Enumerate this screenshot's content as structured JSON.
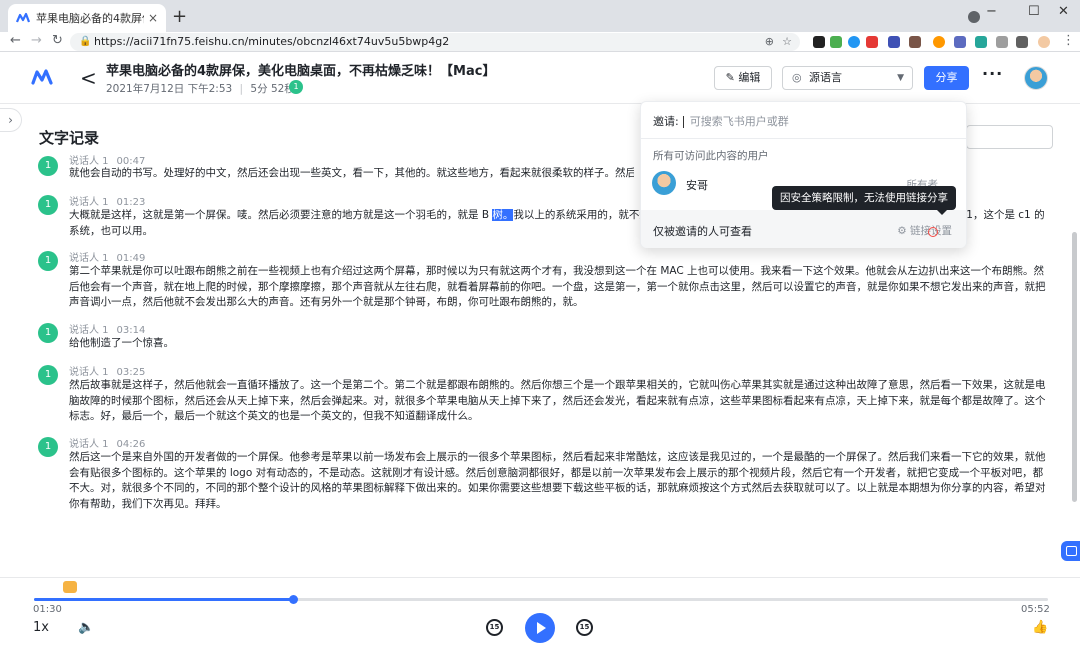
{
  "browser": {
    "tab_title": "苹果电脑必备的4款屏保，美化电脑",
    "tab_close": "×",
    "new_tab": "+",
    "url": "https://acii71fn75.feishu.cn/minutes/obcnzl46xt74uv5u5bwp4g2",
    "window_controls": [
      "−",
      "☐",
      "✕"
    ],
    "nav": {
      "back": "←",
      "forward": "→",
      "reload": "↻"
    },
    "extension_badges": [
      "14",
      "221",
      "0"
    ]
  },
  "header": {
    "back": "<",
    "title": "苹果电脑必备的4款屏保，美化电脑桌面，不再枯燥乏味！【Mac】",
    "date": "2021年7月12日 下午2:53",
    "duration": "5分 52秒",
    "participant_count": "1",
    "edit_label": "编辑",
    "lang_label": "源语言",
    "share_label": "分享",
    "more": "···",
    "brand_color": "#3370ff"
  },
  "transcript": {
    "title": "文字记录",
    "segments": [
      {
        "avatar": "1",
        "speaker": "说话人 1",
        "time": "00:47",
        "text": "就他会自动的书写。处理好的中文，然后还会出现一些英文，看一下，其他的。就这些地方，看起来就很柔软的样子。然后还有"
      },
      {
        "avatar": "1",
        "speaker": "说话人 1",
        "time": "01:23",
        "text_before": "大概就是这样，这就是第一个屏保。唛。然后必须要注意的地方就是这一个羽毛的，就是 B ",
        "text_highlight": "树。",
        "text_after": "我以上的系统采用的，就不知道                                                                                                            这个系统是最新的 mac os 12 码，他也可以用。然后这一个事实1，这个是 c1 的系统，也可以用。"
      },
      {
        "avatar": "1",
        "speaker": "说话人 1",
        "time": "01:49",
        "text": "第二个苹果就是你可以吐跟布朗熊之前在一些视频上也有介绍过这两个屏幕，那时候以为只有就这两个才有，我没想到这一个在 MAC 上也可以使用。我来看一下这个效果。他就会从左边扒出来这一个布朗熊。然后他会有一个声音，就在地上爬的时候，那个摩擦摩擦，那个声音就从左往右爬，就看着屏幕前的你吧。一个盘，这是第一，第一个就你点击这里，然后可以设置它的声音，就是你如果不想它发出来的声音，就把声音调小一点，然后他就不会发出那么大的声音。还有另外一个就是那个钟哥，布朗，你可吐跟布朗熊的，就。"
      },
      {
        "avatar": "1",
        "speaker": "说话人 1",
        "time": "03:14",
        "text": "给他制造了一个惊喜。"
      },
      {
        "avatar": "1",
        "speaker": "说话人 1",
        "time": "03:25",
        "text": "然后故事就是这样子，然后他就会一直循环播放了。这一个是第二个。第二个就是都跟布朗熊的。然后你想三个是一个跟苹果相关的，它就叫伤心苹果其实就是通过这种出故障了意思，然后看一下效果，这就是电脑故障的时候那个图标，然后还会从天上掉下来，然后会弹起来。对，就很多个苹果电脑从天上掉下来了，然后还会发光，看起来就有点凉，这些苹果图标看起来有点凉，天上掉下来，就是每个都是故障了。这个标志。好，最后一个，最后一个就这个英文的也是一个英文的，但我不知道翻译成什么。"
      },
      {
        "avatar": "1",
        "speaker": "说话人 1",
        "time": "04:26",
        "text": "然后这一个是来自外国的开发者做的一个屏保。他参考是苹果以前一场发布会上展示的一很多个苹果图标，然后看起来非常酷炫，这应该是我见过的，一个是最酷的一个屏保了。然后我们来看一下它的效果，就他会有贴很多个图标的。这个苹果的 logo 对有动态的，不是动态。这就刚才有设计感。然后创意脑洞都很好，都是以前一次苹果发布会上展示的那个视频片段，然后它有一个开发者，就把它变成一个平板对吧，都不大。对，就很多个不同的，不同的那个整个设计的风格的苹果图标解释下做出来的。如果你需要这些想要下载这些平板的话，那就麻烦按这个方式然后去获取就可以了。以上就是本期想为你分享的内容，希望对你有帮助，我们下次再见。拜拜。"
      }
    ]
  },
  "share_popover": {
    "invite_label": "邀请:",
    "invite_placeholder": "可搜索飞书用户或群",
    "access_heading": "所有可访问此内容的用户",
    "user_name": "安哥",
    "user_role": "所有者",
    "permission_label": "仅被邀请的人可查看",
    "link_settings": "链接设置",
    "tooltip": "因安全策略限制，无法使用链接分享"
  },
  "player": {
    "current_time": "01:30",
    "total_time": "05:52",
    "progress": 0.2557,
    "speed": "1x",
    "rewind_label": "15",
    "forward_label": "15"
  }
}
